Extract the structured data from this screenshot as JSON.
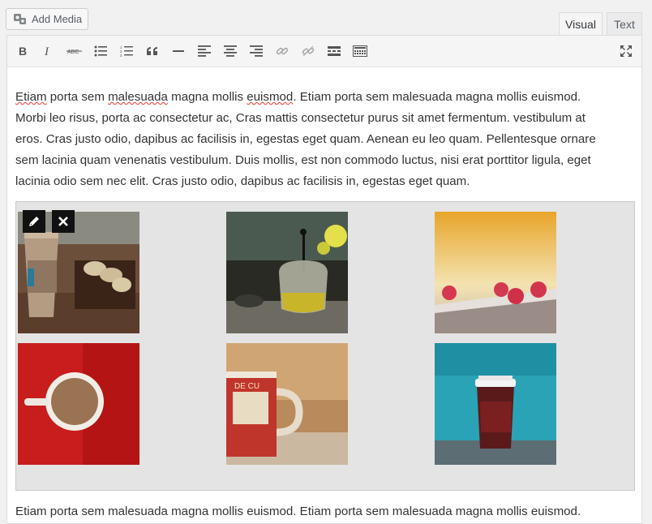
{
  "media_button": {
    "label": "Add Media",
    "icon": "media-icon"
  },
  "tabs": [
    {
      "label": "Visual",
      "active": true
    },
    {
      "label": "Text",
      "active": false
    }
  ],
  "toolbar": {
    "buttons": [
      "bold-icon",
      "italic-icon",
      "strikethrough-icon",
      "bulleted-list-icon",
      "numbered-list-icon",
      "blockquote-icon",
      "horizontal-line-icon",
      "align-left-icon",
      "align-center-icon",
      "align-right-icon",
      "link-icon",
      "unlink-icon",
      "read-more-icon",
      "toolbar-toggle-icon",
      "fullscreen-icon"
    ]
  },
  "content": {
    "paragraph_lines": [
      "Etiam porta sem malesuada magna mollis euismod. Etiam porta sem malesuada magna mollis euismod.",
      "Morbi leo risus, porta ac consectetur ac, Cras mattis consectetur purus sit amet fermentum. vestibulum at",
      "eros. Cras justo odio, dapibus ac facilisis in, egestas eget quam. Aenean eu leo quam. Pellentesque ornare",
      "sem lacinia quam venenatis vestibulum. Duis mollis, est non commodo luctus, nisi erat porttitor ligula, eget",
      "lacinia odio sem nec elit. Cras justo odio, dapibus ac facilisis in, egestas eget quam."
    ],
    "misspelled_words": [
      "Etiam",
      "malesuada",
      "euismod"
    ],
    "bottom_line": "Etiam porta sem malesuada magna mollis euismod. Etiam porta sem malesuada magna mollis euismod."
  },
  "gallery": {
    "tools": [
      "edit-pencil-icon",
      "remove-x-icon"
    ],
    "images": [
      "coffee-cup-macarons-photo",
      "glass-teapot-photo",
      "raspberries-photo",
      "coffee-cup-red-background-photo",
      "red-mug-photo",
      "paper-coffee-cup-blue-background-photo"
    ]
  },
  "colors": {
    "accent": "#e33",
    "gallery_bg": "#e4e4e4",
    "toolbar_bg": "#f5f5f5"
  }
}
